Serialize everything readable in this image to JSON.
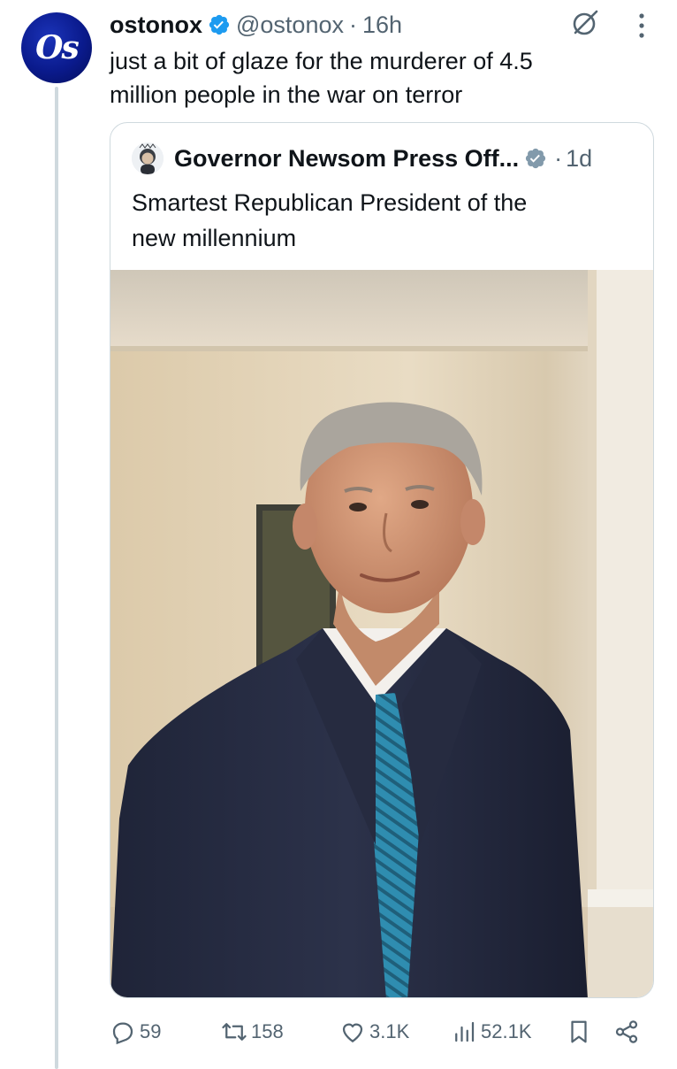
{
  "post": {
    "author_name": "ostonox",
    "handle": "@ostonox",
    "separator": "·",
    "time": "16h",
    "avatar_text": "Os",
    "text": "just a bit of glaze for the murderer of 4.5\nmillion people in the war on terror"
  },
  "quote": {
    "author_name": "Governor Newsom Press Off...",
    "separator": "·",
    "time": "1d",
    "text": "Smartest Republican President of the\nnew millennium"
  },
  "actions": {
    "replies": "59",
    "retweets": "158",
    "likes": "3.1K",
    "views": "52.1K"
  },
  "icons": {
    "verified": "verified-badge-icon",
    "quote_verified": "gray-verified-badge-icon",
    "grok": "grok-icon",
    "more": "more-vertical-icon",
    "reply": "reply-icon",
    "retweet": "retweet-icon",
    "like": "heart-icon",
    "views": "views-icon",
    "bookmark": "bookmark-icon",
    "share": "share-icon"
  },
  "colors": {
    "verified_blue": "#1d9bf0",
    "verified_gray": "#829aab",
    "secondary_text": "#536471",
    "border": "#cfd9de"
  }
}
